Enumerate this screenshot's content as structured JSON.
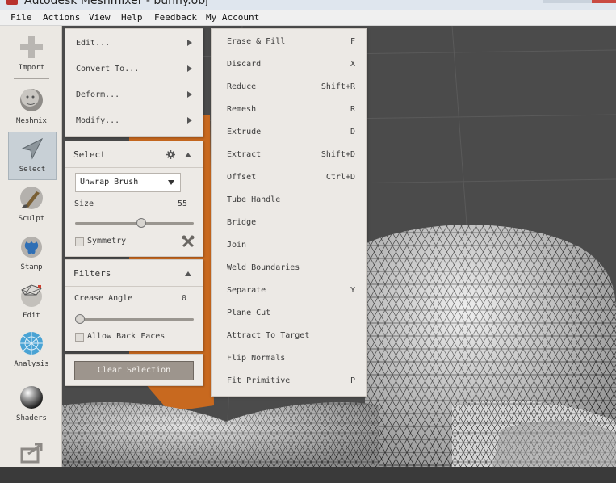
{
  "window": {
    "title": "Autodesk Meshmixer - bunny.obj"
  },
  "menubar": {
    "items": [
      "File",
      "Actions",
      "View",
      "Help",
      "Feedback",
      "My Account"
    ]
  },
  "toolbar": {
    "tools": [
      {
        "label": "Import",
        "icon": "plus-icon"
      },
      {
        "label": "Meshmix",
        "icon": "meshmix-head-icon"
      },
      {
        "label": "Select",
        "icon": "select-arrow-icon"
      },
      {
        "label": "Sculpt",
        "icon": "sculpt-brush-icon"
      },
      {
        "label": "Stamp",
        "icon": "stamp-icon"
      },
      {
        "label": "Edit",
        "icon": "edit-sphere-icon"
      },
      {
        "label": "Analysis",
        "icon": "analysis-globe-icon"
      },
      {
        "label": "Shaders",
        "icon": "shaders-ball-icon"
      },
      {
        "label": "",
        "icon": "export-icon"
      }
    ]
  },
  "select_submenu": {
    "items": [
      "Edit...",
      "Convert To...",
      "Deform...",
      "Modify..."
    ]
  },
  "select_panel": {
    "title": "Select",
    "brush": "Unwrap Brush",
    "size_label": "Size",
    "size_value": "55",
    "size_fraction": 0.55,
    "symmetry_label": "Symmetry"
  },
  "filters_panel": {
    "title": "Filters",
    "crease_label": "Crease Angle",
    "crease_value": "0",
    "crease_fraction": 0.0,
    "allow_back_faces_label": "Allow Back Faces"
  },
  "clear_selection_label": "Clear Selection",
  "edit_menu": {
    "items": [
      {
        "label": "Erase & Fill",
        "key": "F"
      },
      {
        "label": "Discard",
        "key": "X"
      },
      {
        "label": "Reduce",
        "key": "Shift+R"
      },
      {
        "label": "Remesh",
        "key": "R"
      },
      {
        "label": "Extrude",
        "key": "D"
      },
      {
        "label": "Extract",
        "key": "Shift+D"
      },
      {
        "label": "Offset",
        "key": "Ctrl+D"
      },
      {
        "label": "Tube Handle",
        "key": ""
      },
      {
        "label": "Bridge",
        "key": ""
      },
      {
        "label": "Join",
        "key": ""
      },
      {
        "label": "Weld Boundaries",
        "key": ""
      },
      {
        "label": "Separate",
        "key": "Y"
      },
      {
        "label": "Plane Cut",
        "key": ""
      },
      {
        "label": "Attract To Target",
        "key": ""
      },
      {
        "label": "Flip Normals",
        "key": ""
      },
      {
        "label": "Fit Primitive",
        "key": "P"
      }
    ]
  },
  "colors": {
    "accent_select": "#e07a24",
    "panel_bg": "#edeae6",
    "mesh": "#e8e8e8"
  }
}
